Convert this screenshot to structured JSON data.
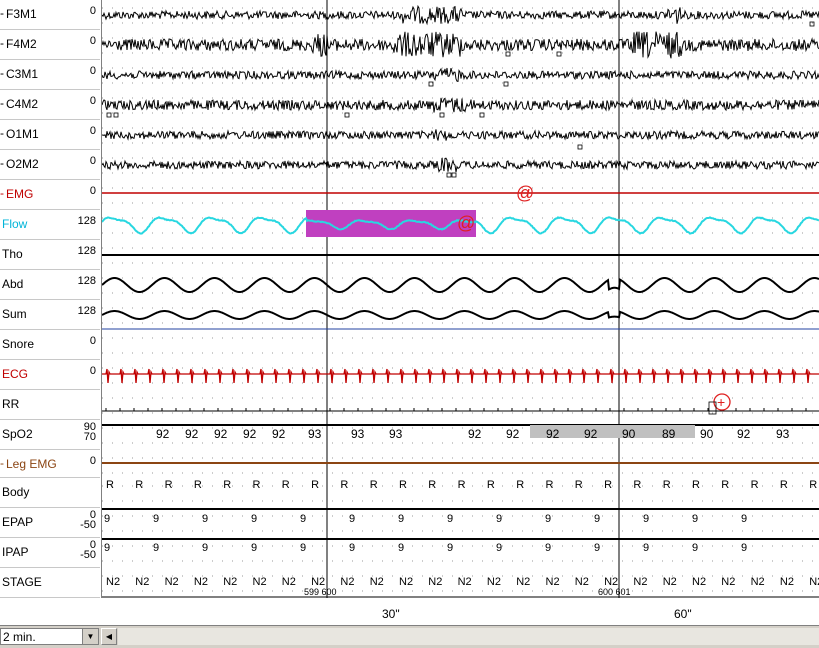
{
  "channels": [
    {
      "name": "F3M1",
      "scale": [
        "0"
      ],
      "color": "#000000",
      "marker": "-"
    },
    {
      "name": "F4M2",
      "scale": [
        "0"
      ],
      "color": "#000000",
      "marker": "-"
    },
    {
      "name": "C3M1",
      "scale": [
        "0"
      ],
      "color": "#000000",
      "marker": "-"
    },
    {
      "name": "C4M2",
      "scale": [
        "0"
      ],
      "color": "#000000",
      "marker": "-"
    },
    {
      "name": "O1M1",
      "scale": [
        "0"
      ],
      "color": "#000000",
      "marker": "-"
    },
    {
      "name": "O2M2",
      "scale": [
        "0"
      ],
      "color": "#000000",
      "marker": "-"
    },
    {
      "name": "EMG",
      "scale": [
        "0"
      ],
      "color": "#c00000",
      "marker": "-"
    },
    {
      "name": "Flow",
      "scale": [
        "128"
      ],
      "color": "#00b4d8",
      "marker": ""
    },
    {
      "name": "Tho",
      "scale": [
        "128"
      ],
      "color": "#000000",
      "marker": ""
    },
    {
      "name": "Abd",
      "scale": [
        "128"
      ],
      "color": "#000000",
      "marker": ""
    },
    {
      "name": "Sum",
      "scale": [
        "128"
      ],
      "color": "#000000",
      "marker": ""
    },
    {
      "name": "Snore",
      "scale": [
        "0"
      ],
      "color": "#000000",
      "marker": ""
    },
    {
      "name": "ECG",
      "scale": [
        "0"
      ],
      "color": "#c00000",
      "marker": ""
    },
    {
      "name": "RR",
      "scale": [],
      "color": "#000000",
      "marker": ""
    },
    {
      "name": "SpO2",
      "scale": [
        "90",
        "70"
      ],
      "color": "#000000",
      "marker": ""
    },
    {
      "name": "Leg EMG",
      "scale": [
        "0"
      ],
      "color": "#8b4513",
      "marker": "-"
    },
    {
      "name": "Body",
      "scale": [],
      "color": "#000000",
      "marker": ""
    },
    {
      "name": "EPAP",
      "scale": [
        "0",
        "-50"
      ],
      "color": "#000000",
      "marker": ""
    },
    {
      "name": "IPAP",
      "scale": [
        "0",
        "-50"
      ],
      "color": "#000000",
      "marker": ""
    },
    {
      "name": "STAGE",
      "scale": [],
      "color": "#000000",
      "marker": ""
    }
  ],
  "events": {
    "flow_event_color": "#c040c0",
    "arousal_symbol": "@",
    "ecg_event_symbol": "+"
  },
  "spo2": {
    "values": [
      "92",
      "92",
      "92",
      "92",
      "92",
      "93",
      "93",
      "93",
      "92",
      "92",
      "92",
      "92",
      "90",
      "89",
      "90",
      "92",
      "93",
      "92"
    ],
    "desat_color": "#c0c0c0"
  },
  "body": {
    "position": "R"
  },
  "epap": {
    "value": "9"
  },
  "ipap": {
    "value": "9"
  },
  "stage": {
    "value": "N2"
  },
  "epochs": {
    "first": "599",
    "first_next": "600",
    "second": "600",
    "second_next": "601"
  },
  "time_axis": {
    "tick_1": "30\"",
    "tick_2": "60\""
  },
  "window_select": {
    "value": "2 min.",
    "options": [
      "2 min."
    ]
  }
}
